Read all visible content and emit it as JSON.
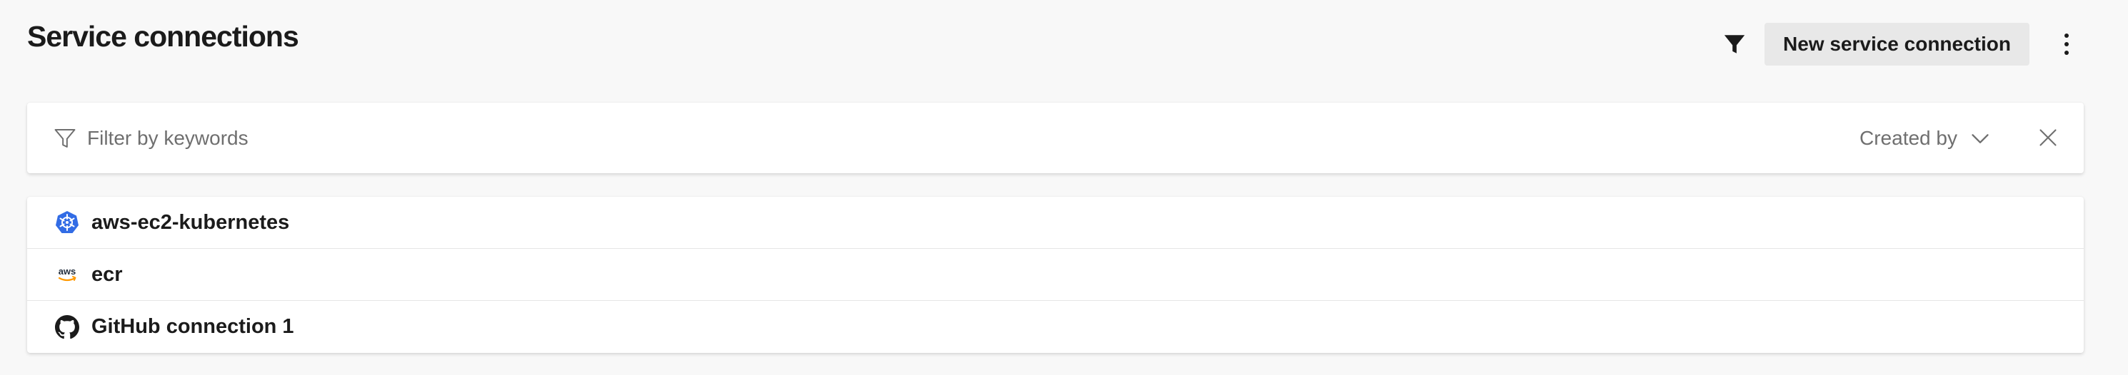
{
  "header": {
    "title": "Service connections",
    "new_button_label": "New service connection"
  },
  "filter": {
    "placeholder": "Filter by keywords",
    "created_by_label": "Created by"
  },
  "connections": [
    {
      "name": "aws-ec2-kubernetes",
      "icon": "kubernetes-icon",
      "icon_color": "#326ce5"
    },
    {
      "name": "ecr",
      "icon": "aws-icon",
      "icon_color": "#ff9900",
      "icon_text": "aws"
    },
    {
      "name": "GitHub connection 1",
      "icon": "github-icon",
      "icon_color": "#1b1b1b"
    }
  ]
}
